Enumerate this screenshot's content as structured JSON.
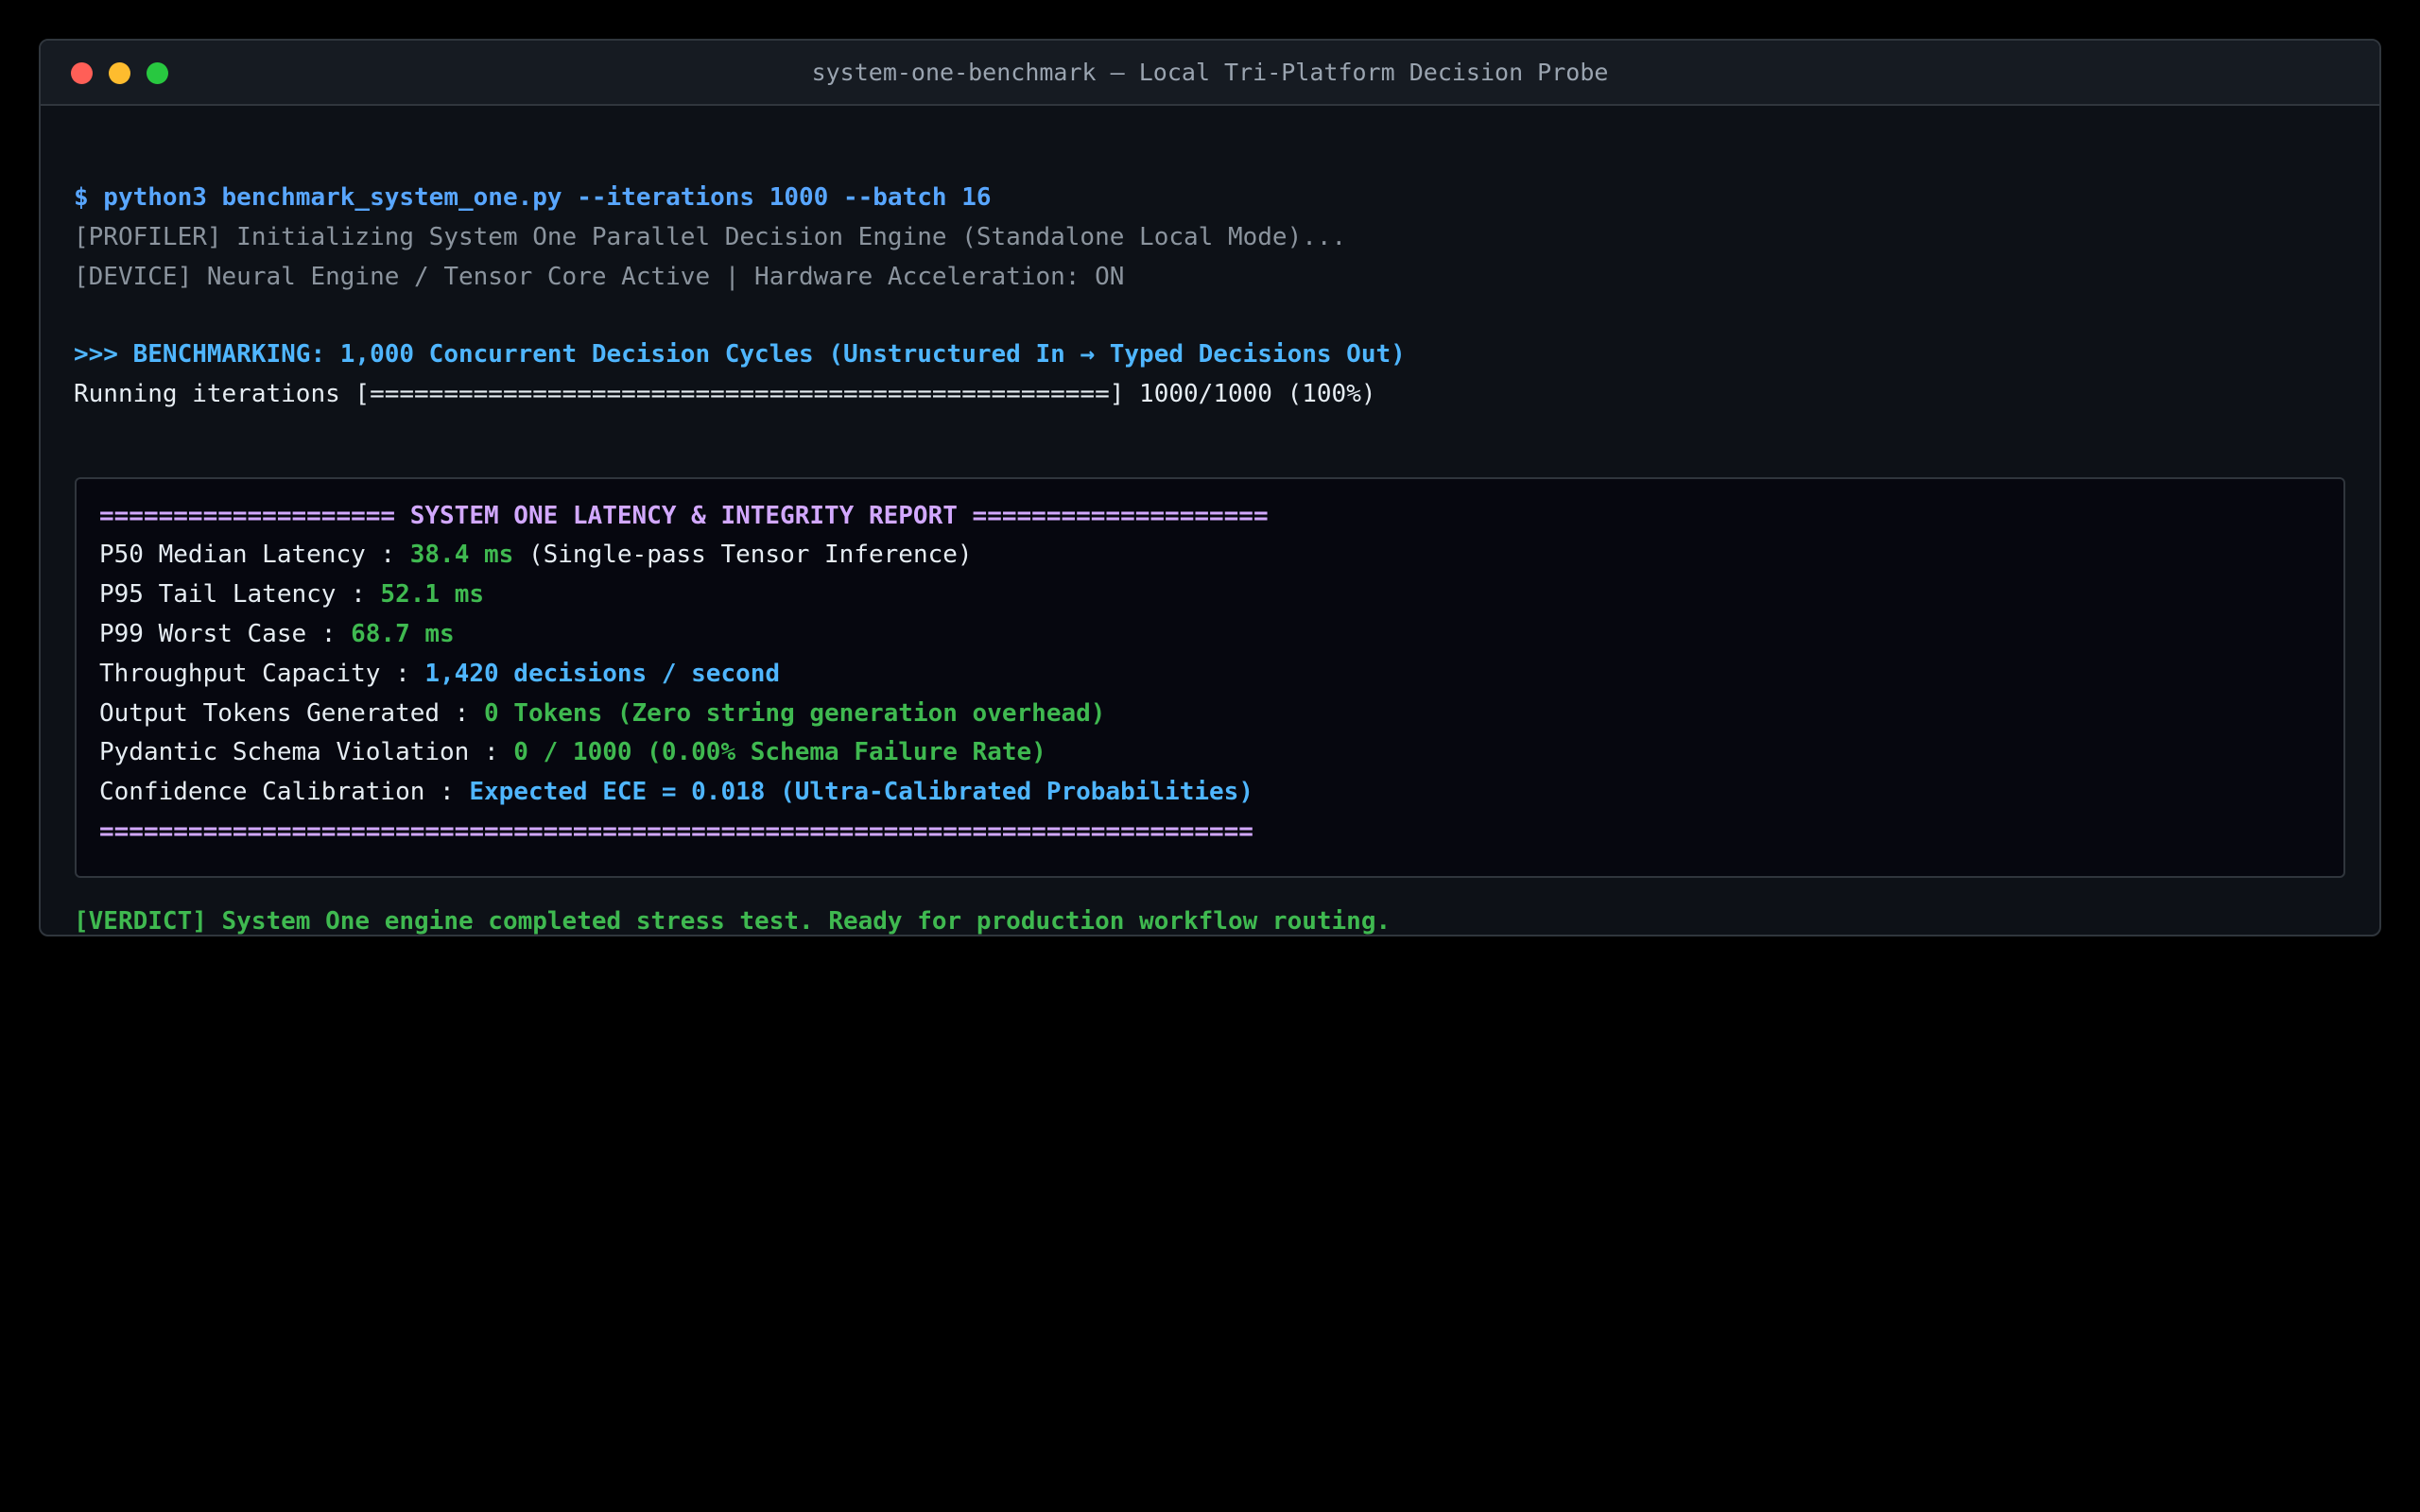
{
  "window": {
    "title": "system-one-benchmark — Local Tri-Platform Decision Probe"
  },
  "terminal": {
    "command": "$ python3 benchmark_system_one.py --iterations 1000 --batch 16",
    "profiler_line": "[PROFILER] Initializing System One Parallel Decision Engine (Standalone Local Mode)...",
    "device_line": "[DEVICE] Neural Engine / Tensor Core Active | Hardware Acceleration: ON",
    "bench_line": ">>> BENCHMARKING: 1,000 Concurrent Decision Cycles (Unstructured In → Typed Decisions Out)",
    "progress_label": "Running iterations [==================================================]",
    "progress_count": "1000/1000",
    "progress_percent": "(100%)",
    "progress_fraction": 1.0
  },
  "report": {
    "header": "==================== SYSTEM ONE LATENCY & INTEGRITY REPORT ====================",
    "rows": [
      {
        "label": "P50 Median Latency : ",
        "value": "38.4 ms",
        "note": " (Single-pass Tensor Inference)"
      },
      {
        "label": "P95 Tail Latency : ",
        "value": "52.1 ms",
        "note": ""
      },
      {
        "label": "P99 Worst Case : ",
        "value": "68.7 ms",
        "note": ""
      },
      {
        "label": "Throughput Capacity : ",
        "value": "1,420 decisions / second",
        "note": ""
      },
      {
        "label": "Output Tokens Generated : ",
        "value": "0 Tokens (Zero string generation overhead)",
        "note": ""
      },
      {
        "label": "Pydantic Schema Violation : ",
        "value": "0 / 1000 (0.00% Schema Failure Rate)",
        "note": ""
      },
      {
        "label": "Confidence Calibration : ",
        "value": "Expected ECE = 0.018 (Ultra-Calibrated Probabilities)",
        "note": ""
      }
    ],
    "footer": "=============================================================================="
  },
  "verdict": "[VERDICT] System One engine completed stress test. Ready for production workflow routing.",
  "colors": {
    "command": "#58a6ff",
    "metric_green": "#3fb950",
    "metric_blue": "#4fb6ff",
    "report_header": "#d2a8ff",
    "background": "#0d1117"
  }
}
